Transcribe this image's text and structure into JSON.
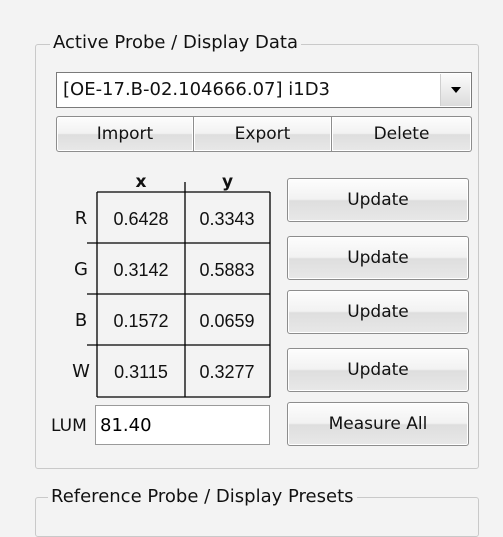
{
  "active_group": {
    "title": "Active Probe / Display Data"
  },
  "probe_select": {
    "value": "[OE-17.B-02.104666.07] i1D3"
  },
  "actions": {
    "import": "Import",
    "export": "Export",
    "delete": "Delete"
  },
  "table": {
    "columns": [
      "x",
      "y"
    ],
    "rows": [
      {
        "label": "R",
        "x": "0.6428",
        "y": "0.3343",
        "button": "Update"
      },
      {
        "label": "G",
        "x": "0.3142",
        "y": "0.5883",
        "button": "Update"
      },
      {
        "label": "B",
        "x": "0.1572",
        "y": "0.0659",
        "button": "Update"
      },
      {
        "label": "W",
        "x": "0.3115",
        "y": "0.3277",
        "button": "Update"
      }
    ]
  },
  "lum": {
    "label": "LUM",
    "value": "81.40"
  },
  "measure_all": "Measure All",
  "reference_group": {
    "title": "Reference Probe / Display Presets"
  }
}
